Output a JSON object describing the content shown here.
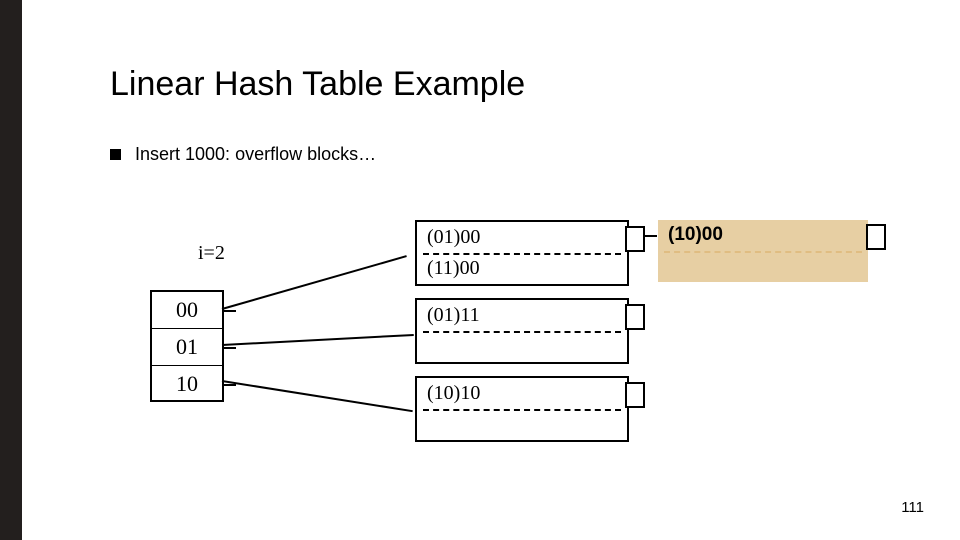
{
  "title": "Linear Hash Table Example",
  "bullet": "Insert 1000: overflow blocks…",
  "i_label": "i=2",
  "directory": [
    "00",
    "01",
    "10"
  ],
  "buckets": [
    {
      "r1": "(01)00",
      "r2": "(11)00"
    },
    {
      "r1": "(01)11",
      "r2": ""
    },
    {
      "r1": "(10)10",
      "r2": ""
    }
  ],
  "overflow": {
    "r1": "(10)00"
  },
  "page_number": "111"
}
